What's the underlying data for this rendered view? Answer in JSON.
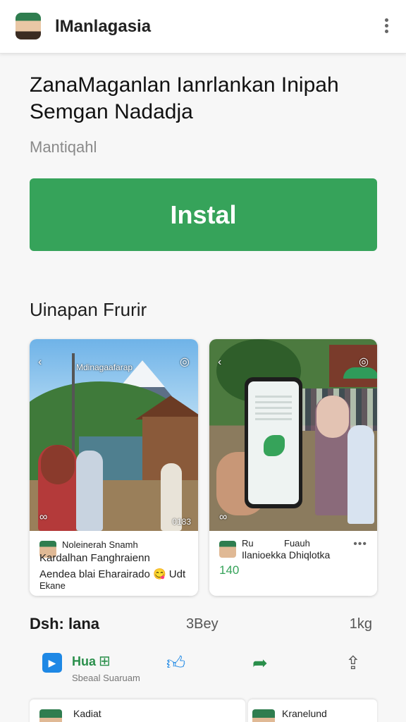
{
  "header": {
    "app_name": "lManlagasia"
  },
  "listing": {
    "headline_line1": "ZanaMaganlan Ianrlankan Inipah",
    "headline_line2": "Semgan Nadadja",
    "developer": "Mantiqahl",
    "install_label": "Instal"
  },
  "screenshots": {
    "section_title": "Uinapan Frurir",
    "cards": [
      {
        "overlay_text": "Mdinagaafarap",
        "badge": "0183",
        "caption_name": "Noleinerah Snamh",
        "caption_line1": "Kardalhan Fanghraienn",
        "caption_line2": "Aendea blai Eharairado 😋 Udt",
        "caption_line3": "Ekane"
      },
      {
        "caption_name": "Ru",
        "caption_tag": "Fuauh",
        "caption_line1": "Ilanioekka Dhiqlotka",
        "caption_count": "140"
      }
    ]
  },
  "stats": {
    "label": "Dsh: lana",
    "middle": "3Bey",
    "right": "1kg"
  },
  "actions": {
    "primary_label": "Hua",
    "primary_sub": "Sbeaal Suaruam"
  },
  "peek": {
    "left_title": "Kadiat",
    "right_title": "Kranelund"
  },
  "icons": {
    "menu": "more-vert-icon",
    "back": "chevron-left-icon",
    "like": "thumbs-up-icon",
    "share": "share-arrow-icon",
    "export": "share-box-icon"
  },
  "colors": {
    "accent": "#36a35a",
    "link_blue": "#1e88e5"
  }
}
